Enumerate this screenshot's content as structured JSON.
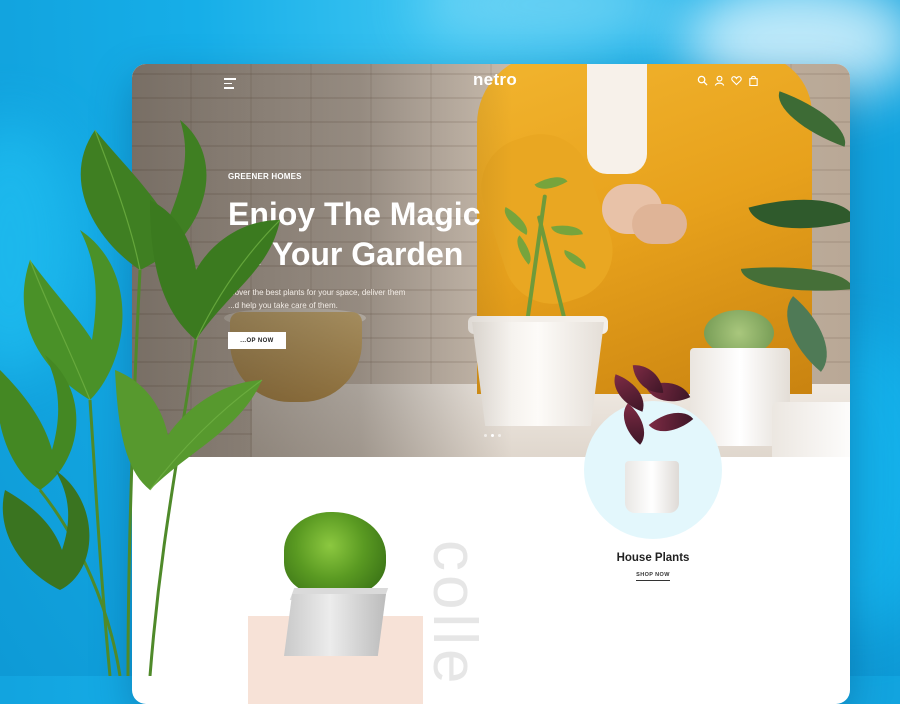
{
  "colors": {
    "backdrop": "#16aee8",
    "accent_circle": "#e3f7fc",
    "pink_block": "#f7e2d7",
    "jacket": "#e7a11c"
  },
  "nav": {
    "logo": "netro",
    "menu_icon": "hamburger-icon",
    "icons": [
      "search-icon",
      "user-icon",
      "heart-icon",
      "bag-icon"
    ]
  },
  "hero": {
    "eyebrow": "GREENER HOMES",
    "headline_line1": "Enjoy The Magic",
    "headline_line2": "Of Your Garden",
    "desc_line1": "...over the best plants for your space, deliver them",
    "desc_line2": "...d help you take care of them.",
    "cta": "...OP NOW",
    "slides": 3,
    "active_slide": 1
  },
  "collection": {
    "vertical_word": "colle"
  },
  "featured": {
    "title": "House Plants",
    "link": "SHOP NOW"
  }
}
